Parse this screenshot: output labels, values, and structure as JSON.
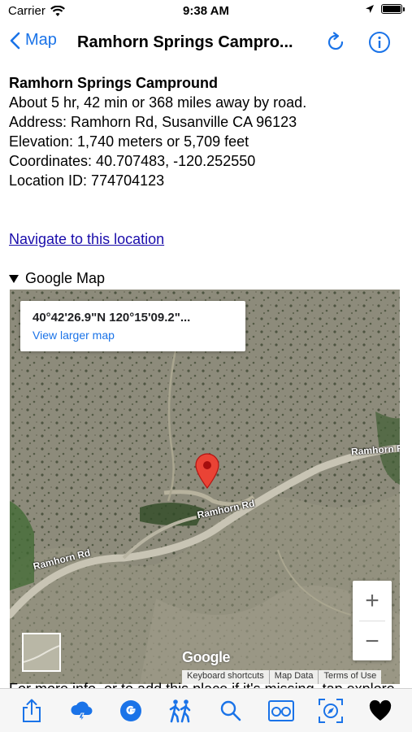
{
  "status": {
    "carrier": "Carrier",
    "time": "9:38 AM",
    "battery_level": 1.0
  },
  "nav": {
    "back_label": "Map",
    "title": "Ramhorn Springs  Campro..."
  },
  "place": {
    "name": "Ramhorn Springs Campround",
    "distance": "About 5 hr, 42 min or 368 miles away by road.",
    "address": "Address: Ramhorn Rd, Susanville CA 96123",
    "elevation": "Elevation: 1,740 meters or 5,709 feet",
    "coordinates": "Coordinates: 40.707483, -120.252550",
    "location_id": "Location ID: 774704123"
  },
  "links": {
    "navigate": "Navigate to this location"
  },
  "google_map": {
    "summary": "Google Map",
    "card_coords": "40°42'26.9\"N 120°15'09.2\"...",
    "view_larger": "View larger map",
    "road_label": "Ramhorn Rd",
    "zoom_in": "+",
    "zoom_out": "−",
    "logo": "Google",
    "attribution": [
      "Keyboard shortcuts",
      "Map Data",
      "Terms of Use"
    ]
  },
  "footer_text": "For more info, or to add this place if it's missing, tap explore location...",
  "toolbar": {
    "icons": [
      "share-icon",
      "weather-icon",
      "google-icon",
      "hikers-icon",
      "search-icon",
      "binoculars-icon",
      "compass-icon",
      "favorite-icon"
    ]
  },
  "colors": {
    "accent": "#1a73e8",
    "pin": "#ea4335",
    "link": "#1a0dab"
  }
}
